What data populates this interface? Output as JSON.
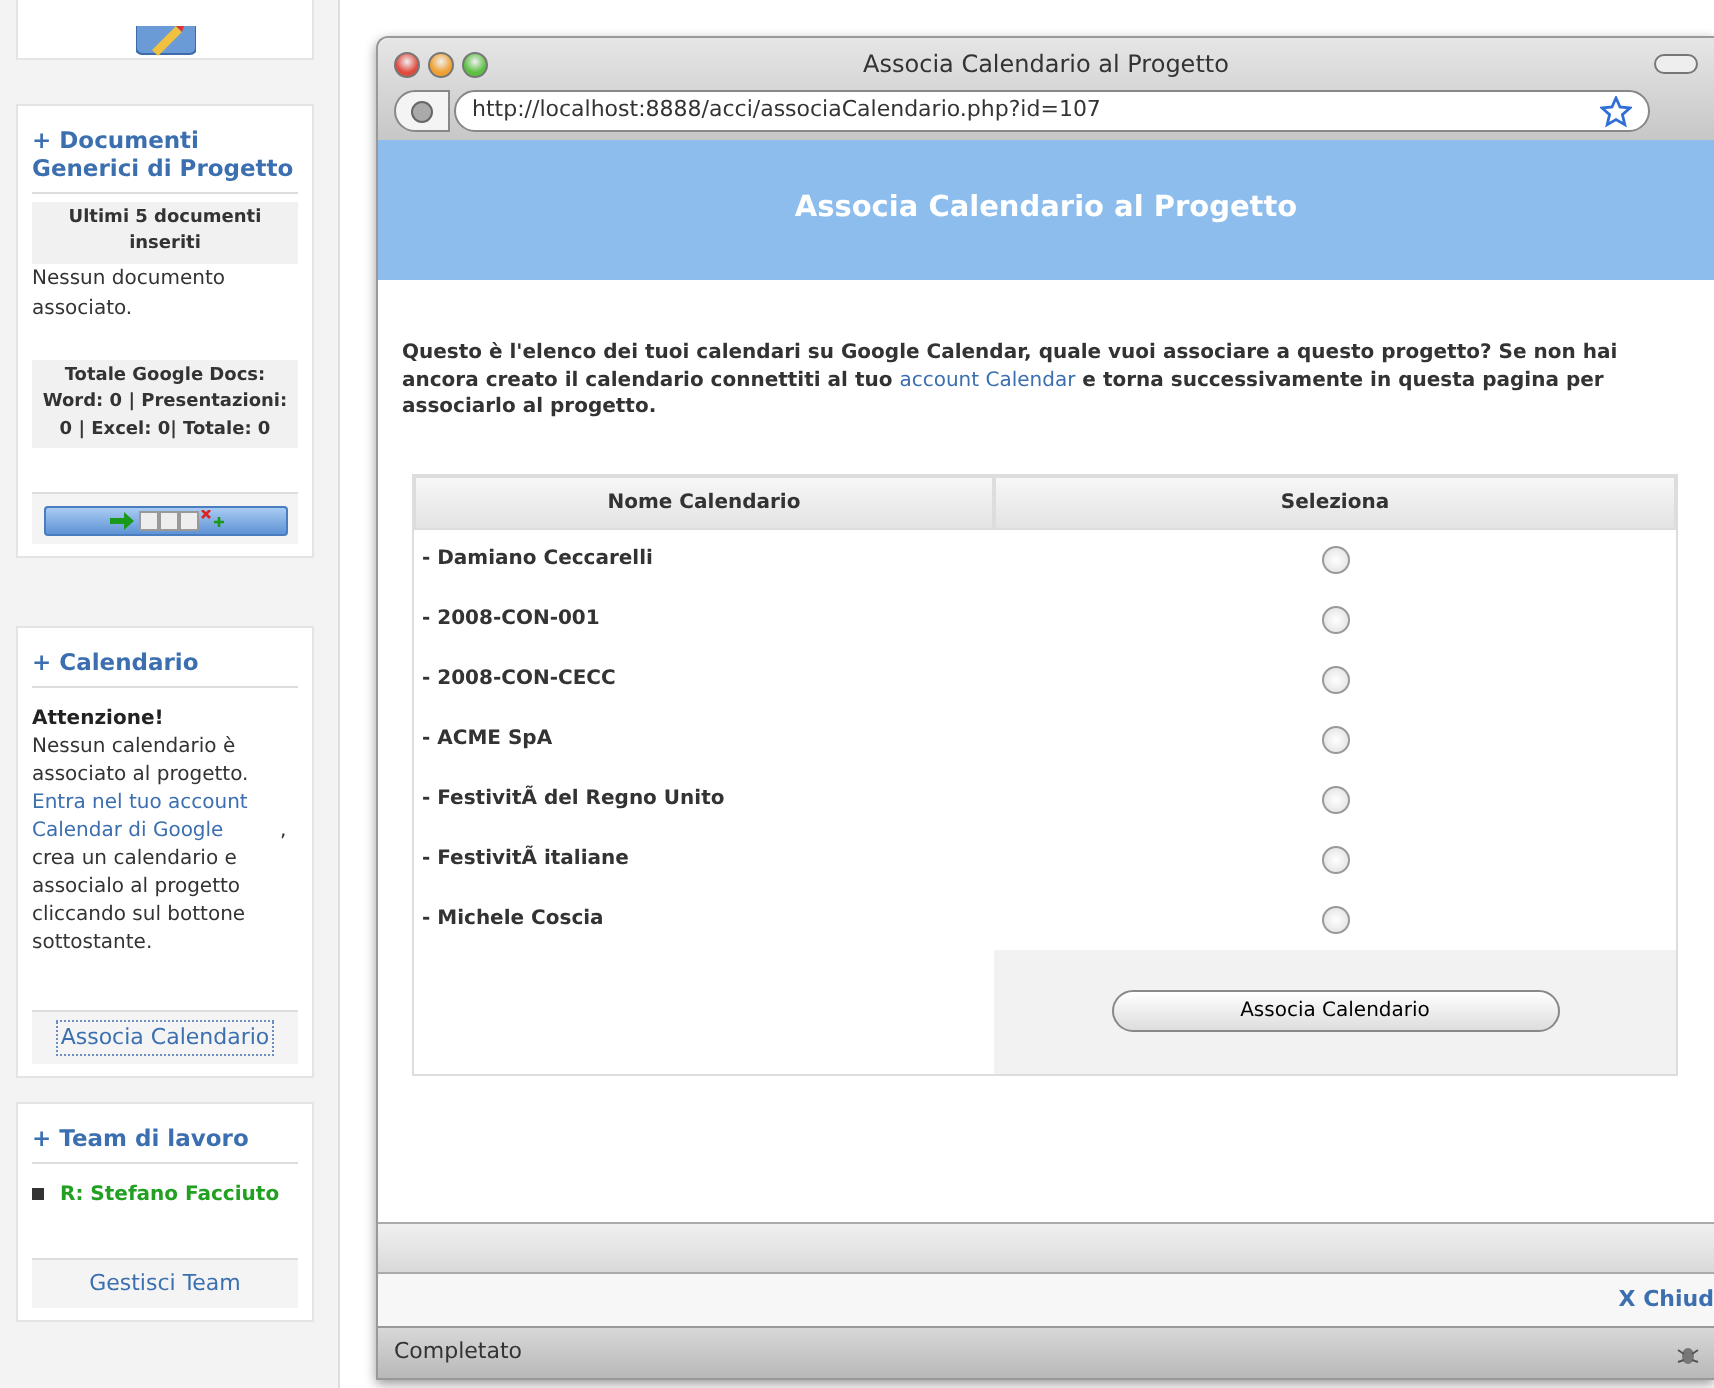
{
  "sidebar": {
    "documents": {
      "title": "+ Documenti Generici di Progetto",
      "subheading": "Ultimi 5 documenti inseriti",
      "empty": "Nessun documento associato.",
      "totals": "Totale Google Docs: Word: 0 | Presentazioni: 0 | Excel: 0| Totale: 0"
    },
    "calendar": {
      "title": "+ Calendario",
      "warning": "Attenzione!",
      "text_before": "Nessun calendario è associato al progetto. ",
      "link": "Entra nel tuo account Calendar di Google",
      "text_after": ", crea un calendario e associalo al progetto cliccando sul bottone sottostante.",
      "button": "Associa Calendario"
    },
    "team": {
      "title": "+ Team di lavoro",
      "members": [
        {
          "name": "R: Stefano Facciuto"
        }
      ],
      "button": "Gestisci Team"
    }
  },
  "window": {
    "title": "Associa Calendario al Progetto",
    "url": "http://localhost:8888/acci/associaCalendario.php?id=107",
    "heading": "Associa Calendario al Progetto",
    "intro": {
      "before": "Questo è l'elenco dei tuoi calendari su Google Calendar, quale vuoi associare a questo progetto? Se non hai ancora creato il calendario connettiti al tuo ",
      "link": "account Calendar",
      "after": " e torna successivamente in questa pagina per associarlo al progetto."
    },
    "table": {
      "columns": [
        "Nome Calendario",
        "Seleziona"
      ],
      "rows": [
        {
          "name": "- Damiano Ceccarelli",
          "selected": false
        },
        {
          "name": "- 2008-CON-001",
          "selected": false
        },
        {
          "name": "- 2008-CON-CECC",
          "selected": false
        },
        {
          "name": "- ACME SpA",
          "selected": false
        },
        {
          "name": "- FestivitÃ  del Regno Unito",
          "selected": false
        },
        {
          "name": "- FestivitÃ  italiane",
          "selected": false
        },
        {
          "name": "- Michele Coscia",
          "selected": false
        }
      ],
      "submit": "Associa Calendario"
    },
    "close_link": "X Chiud",
    "status": "Completato"
  }
}
